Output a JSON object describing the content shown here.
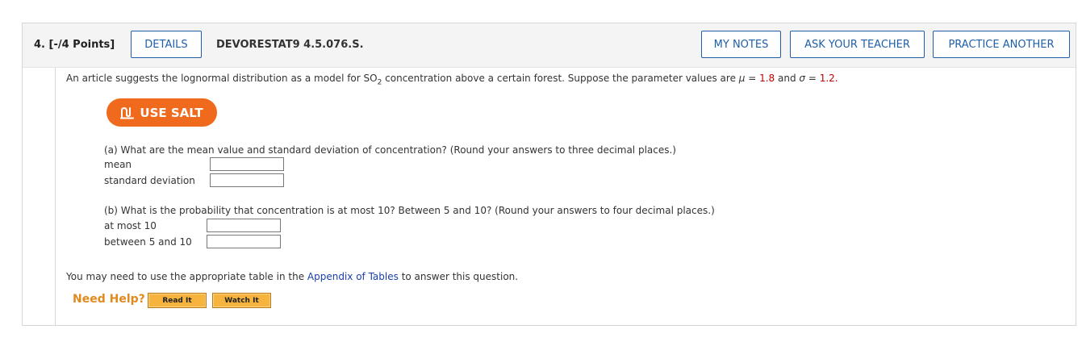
{
  "header": {
    "question_number": "4.",
    "points": "[-/4 Points]",
    "details_label": "DETAILS",
    "question_code": "DEVORESTAT9 4.5.076.S.",
    "my_notes_label": "MY NOTES",
    "ask_teacher_label": "ASK YOUR TEACHER",
    "practice_another_label": "PRACTICE ANOTHER"
  },
  "problem": {
    "text_before": "An article suggests the lognormal distribution as a model for SO",
    "subscript": "2",
    "text_middle": " concentration above a certain forest. Suppose the parameter values are ",
    "mu_symbol": "μ",
    "mu_eq": " = ",
    "mu_value": "1.8",
    "and_text": " and ",
    "sigma_symbol": "σ",
    "sigma_eq": " = ",
    "sigma_value": "1.2",
    "period": "."
  },
  "salt_button": {
    "label": "USE SALT",
    "icon": "salt-icon",
    "color": "#ef6a1c"
  },
  "part_a": {
    "question": "(a) What are the mean value and standard deviation of concentration? (Round your answers to three decimal places.)",
    "fields": [
      {
        "label": "mean",
        "value": ""
      },
      {
        "label": "standard deviation",
        "value": ""
      }
    ]
  },
  "part_b": {
    "question": "(b) What is the probability that concentration is at most 10? Between 5 and 10? (Round your answers to four decimal places.)",
    "fields": [
      {
        "label": "at most 10",
        "value": ""
      },
      {
        "label": "between 5 and 10",
        "value": ""
      }
    ]
  },
  "footer": {
    "appendix_before": "You may need to use the appropriate table in the ",
    "appendix_link": "Appendix of Tables",
    "appendix_after": " to answer this question.",
    "need_help": "Need Help?",
    "read_it": "Read It",
    "watch_it": "Watch It"
  },
  "colors": {
    "accent_blue": "#1f5fa8",
    "value_red": "#c00000",
    "help_orange": "#e08a1e",
    "help_button": "#f6b33d"
  }
}
